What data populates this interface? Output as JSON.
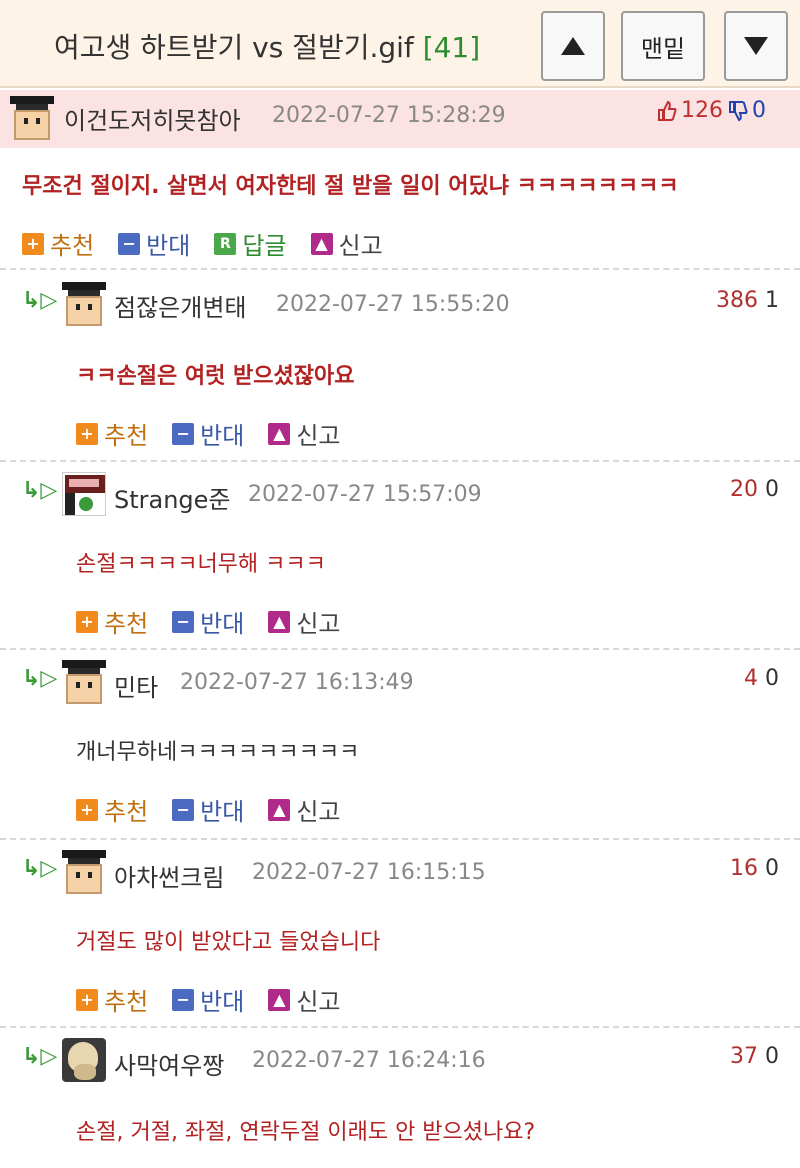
{
  "header": {
    "title": "여고생 하트받기 vs 절받기.gif",
    "count": "[41]",
    "up_label": "▲",
    "bottom_label": "맨밑",
    "down_label": "▼"
  },
  "best": {
    "nick": "이건도저히못참아",
    "time": "2022-07-27 15:28:29",
    "up": "126",
    "down": "0",
    "text": "무조건 절이지. 살면서 여자한테 절 받을 일이 어딨냐 ㅋㅋㅋㅋㅋㅋㅋㅋ",
    "actions": {
      "rec": "추천",
      "opp": "반대",
      "rep": "답글",
      "rpt": "신고",
      "rep_icon": "R"
    }
  },
  "actions": {
    "rec": "추천",
    "opp": "반대",
    "rpt": "신고"
  },
  "replies": [
    {
      "nick": "점잖은개변태",
      "time": "2022-07-27 15:55:20",
      "up": "386",
      "down": "1",
      "text": "ㅋㅋ손절은 여럿 받으셨잖아요"
    },
    {
      "nick": "Strange준",
      "time": "2022-07-27 15:57:09",
      "up": "20",
      "down": "0",
      "text": "손절ㅋㅋㅋㅋ너무해 ㅋㅋㅋ"
    },
    {
      "nick": "민타",
      "time": "2022-07-27 16:13:49",
      "up": "4",
      "down": "0",
      "text": "개너무하네ㅋㅋㅋㅋㅋㅋㅋㅋㅋ"
    },
    {
      "nick": "아차썬크림",
      "time": "2022-07-27 16:15:15",
      "up": "16",
      "down": "0",
      "text": "거절도 많이 받았다고 들었습니다"
    },
    {
      "nick": "사막여우짱",
      "time": "2022-07-27 16:24:16",
      "up": "37",
      "down": "0",
      "text": "손절, 거절, 좌절, 연락두절 이래도 안 받으셨나요?"
    }
  ]
}
